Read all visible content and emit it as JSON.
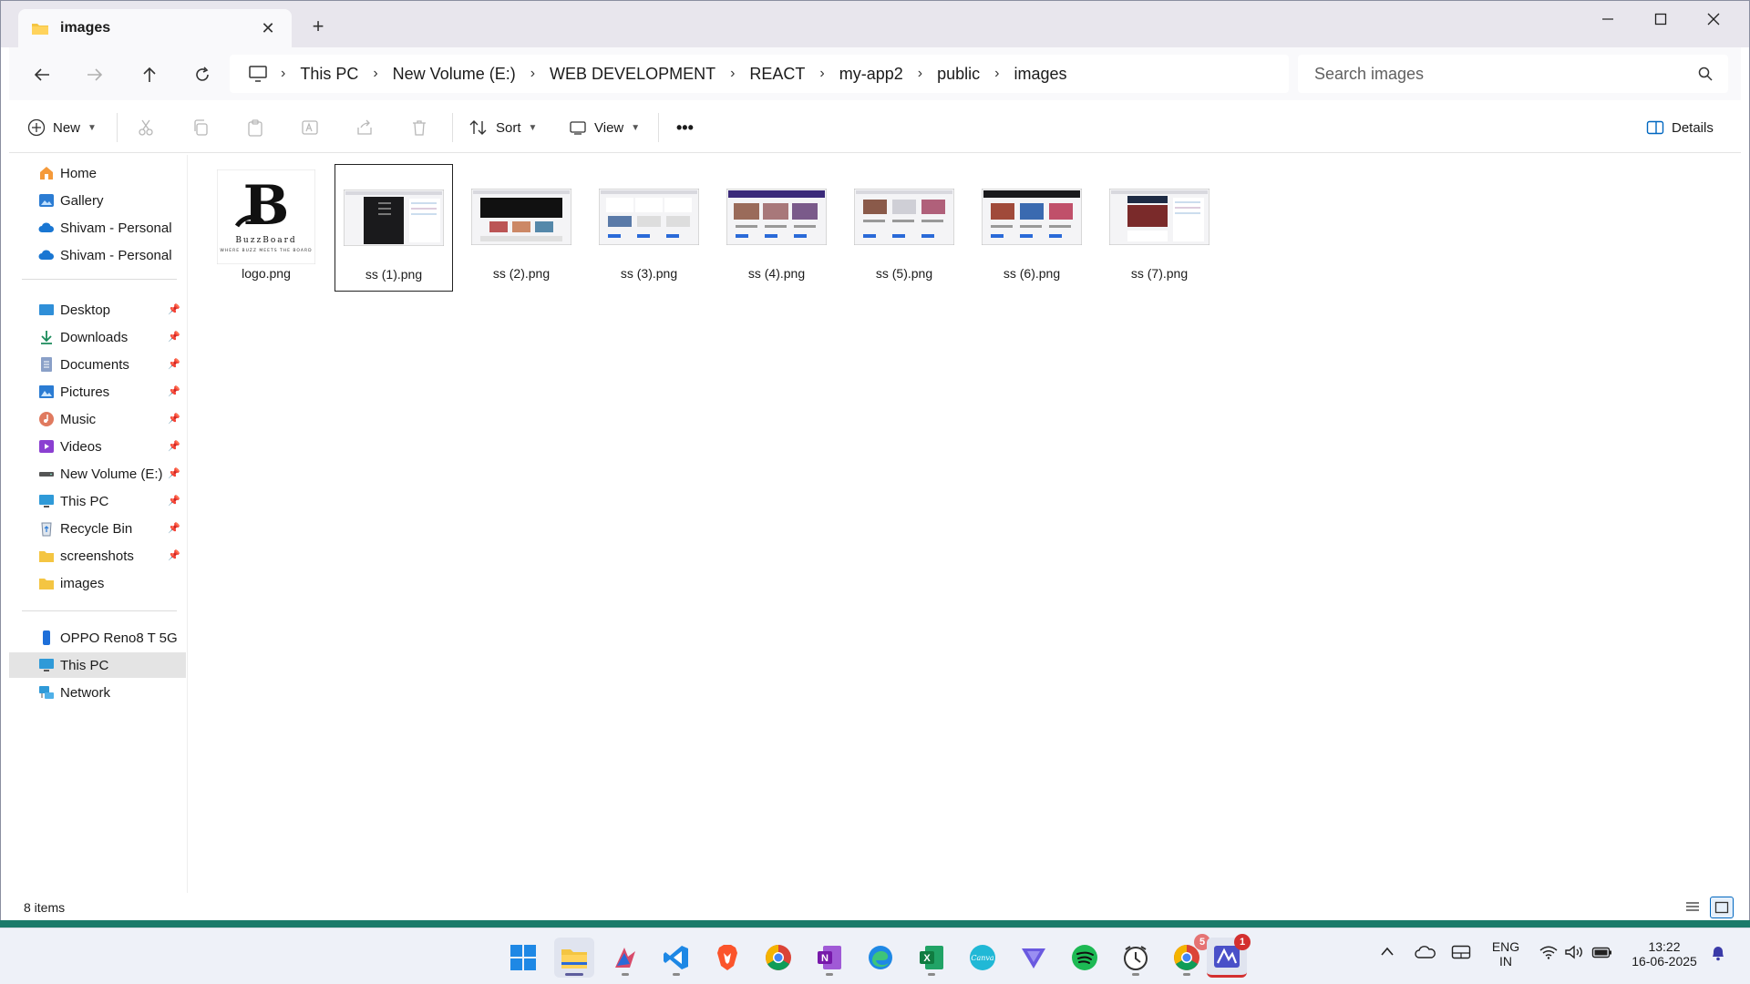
{
  "tab": {
    "title": "images"
  },
  "breadcrumb": [
    "This PC",
    "New Volume (E:)",
    "WEB DEVELOPMENT",
    "REACT",
    "my-app2",
    "public",
    "images"
  ],
  "search": {
    "placeholder": "Search images"
  },
  "toolbar": {
    "new_label": "New",
    "sort_label": "Sort",
    "view_label": "View",
    "details_label": "Details",
    "more_label": "•••"
  },
  "sidebar": {
    "quick": [
      "Home",
      "Gallery",
      "Shivam - Personal",
      "Shivam - Personal"
    ],
    "pinned": [
      "Desktop",
      "Downloads",
      "Documents",
      "Pictures",
      "Music",
      "Videos",
      "New Volume (E:)",
      "This PC",
      "Recycle Bin",
      "screenshots",
      "images"
    ],
    "devices": [
      "OPPO Reno8 T 5G",
      "This PC",
      "Network"
    ]
  },
  "files": [
    "logo.png",
    "ss (1).png",
    "ss (2).png",
    "ss (3).png",
    "ss (4).png",
    "ss (5).png",
    "ss (6).png",
    "ss (7).png"
  ],
  "logo_thumb": {
    "title": "BuzzBoard",
    "tagline": "WHERE BUZZ MEETS THE BOARD"
  },
  "status": {
    "items": "8 items"
  },
  "taskbar": {
    "badge_chrome": "5",
    "badge_app": "1",
    "lang": "ENG",
    "region": "IN",
    "time": "13:22",
    "date": "16-06-2025"
  },
  "colors": {
    "accent": "#0067c0",
    "folder": "#f4c542",
    "selection": "#e4e4e4"
  }
}
